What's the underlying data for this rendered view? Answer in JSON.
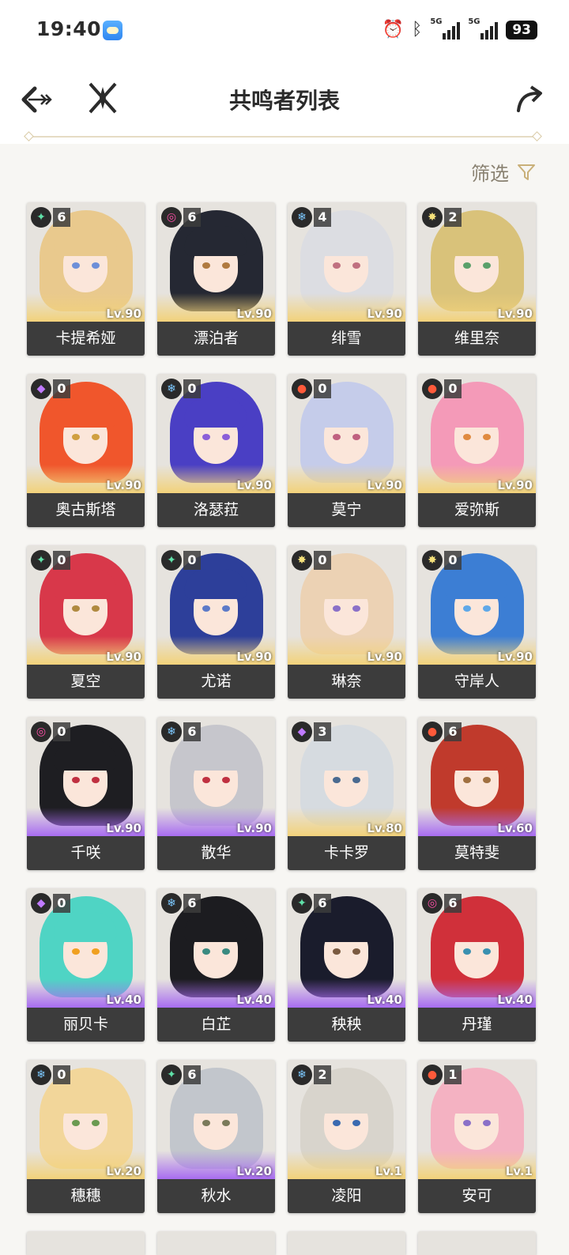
{
  "status_bar": {
    "time": "19:40",
    "battery": "93",
    "signal1_tag": "5G",
    "signal2_tag": "5G"
  },
  "header": {
    "title": "共鸣者列表"
  },
  "filter": {
    "label": "筛选"
  },
  "colors": {
    "accent": "#c9b079",
    "namebar": "#3c3c3c",
    "card_bg": "#e6e3de",
    "purple_glow": "#a86cf0",
    "gold_glow": "#f2d27a"
  },
  "elements": {
    "aero": {
      "glyph": "✦",
      "color": "#5fe0a8"
    },
    "spectro": {
      "glyph": "✸",
      "color": "#f4e07a"
    },
    "glacio": {
      "glyph": "❄",
      "color": "#7cc8ff"
    },
    "fusion": {
      "glyph": "●",
      "color": "#ff5a3a"
    },
    "electro": {
      "glyph": "◆",
      "color": "#c07aff"
    },
    "havoc": {
      "glyph": "◎",
      "color": "#ff4fa8"
    }
  },
  "characters": [
    {
      "name": "卡提希娅",
      "level": "Lv.90",
      "constellation": "6",
      "element": "aero",
      "rarity": "5",
      "hair": "#e9c98d",
      "eye": "#6d8fd8"
    },
    {
      "name": "漂泊者",
      "level": "Lv.90",
      "constellation": "6",
      "element": "havoc",
      "rarity": "5",
      "hair": "#252833",
      "eye": "#b07a40"
    },
    {
      "name": "绯雪",
      "level": "Lv.90",
      "constellation": "4",
      "element": "glacio",
      "rarity": "5",
      "hair": "#dcdde2",
      "eye": "#c07080"
    },
    {
      "name": "维里奈",
      "level": "Lv.90",
      "constellation": "2",
      "element": "spectro",
      "rarity": "5",
      "hair": "#d9c27a",
      "eye": "#5aa06a"
    },
    {
      "name": "奥古斯塔",
      "level": "Lv.90",
      "constellation": "0",
      "element": "electro",
      "rarity": "5",
      "hair": "#f0562c",
      "eye": "#d0a040"
    },
    {
      "name": "洛瑟菈",
      "level": "Lv.90",
      "constellation": "0",
      "element": "glacio",
      "rarity": "5",
      "hair": "#4a3fc4",
      "eye": "#8b5ed8"
    },
    {
      "name": "莫宁",
      "level": "Lv.90",
      "constellation": "0",
      "element": "fusion",
      "rarity": "5",
      "hair": "#c5ccea",
      "eye": "#c06080"
    },
    {
      "name": "爱弥斯",
      "level": "Lv.90",
      "constellation": "0",
      "element": "fusion",
      "rarity": "5",
      "hair": "#f49ab8",
      "eye": "#e08a40"
    },
    {
      "name": "夏空",
      "level": "Lv.90",
      "constellation": "0",
      "element": "aero",
      "rarity": "5",
      "hair": "#d8384a",
      "eye": "#b08a40"
    },
    {
      "name": "尤诺",
      "level": "Lv.90",
      "constellation": "0",
      "element": "aero",
      "rarity": "5",
      "hair": "#2d3f9a",
      "eye": "#5c7ac8"
    },
    {
      "name": "琳奈",
      "level": "Lv.90",
      "constellation": "0",
      "element": "spectro",
      "rarity": "5",
      "hair": "#ecd2b4",
      "eye": "#8a70c8"
    },
    {
      "name": "守岸人",
      "level": "Lv.90",
      "constellation": "0",
      "element": "spectro",
      "rarity": "5",
      "hair": "#3c7ed4",
      "eye": "#5fa8e8"
    },
    {
      "name": "千咲",
      "level": "Lv.90",
      "constellation": "0",
      "element": "havoc",
      "rarity": "4",
      "hair": "#1e1e22",
      "eye": "#c03040"
    },
    {
      "name": "散华",
      "level": "Lv.90",
      "constellation": "6",
      "element": "glacio",
      "rarity": "4",
      "hair": "#c6c6cc",
      "eye": "#c03040"
    },
    {
      "name": "卡卡罗",
      "level": "Lv.80",
      "constellation": "3",
      "element": "electro",
      "rarity": "5",
      "hair": "#d6dbe0",
      "eye": "#4a6a90"
    },
    {
      "name": "莫特斐",
      "level": "Lv.60",
      "constellation": "6",
      "element": "fusion",
      "rarity": "4",
      "hair": "#c03a2c",
      "eye": "#a07040"
    },
    {
      "name": "丽贝卡",
      "level": "Lv.40",
      "constellation": "0",
      "element": "electro",
      "rarity": "4",
      "hair": "#4fd4c4",
      "eye": "#f0a020"
    },
    {
      "name": "白芷",
      "level": "Lv.40",
      "constellation": "6",
      "element": "glacio",
      "rarity": "4",
      "hair": "#1c1c20",
      "eye": "#3a8a80"
    },
    {
      "name": "秧秧",
      "level": "Lv.40",
      "constellation": "6",
      "element": "aero",
      "rarity": "4",
      "hair": "#1a1c2c",
      "eye": "#7a5a40"
    },
    {
      "name": "丹瑾",
      "level": "Lv.40",
      "constellation": "6",
      "element": "havoc",
      "rarity": "4",
      "hair": "#d0303a",
      "eye": "#3a90b0"
    },
    {
      "name": "穗穗",
      "level": "Lv.20",
      "constellation": "0",
      "element": "glacio",
      "rarity": "5",
      "hair": "#f2d69a",
      "eye": "#6a9a50"
    },
    {
      "name": "秋水",
      "level": "Lv.20",
      "constellation": "6",
      "element": "aero",
      "rarity": "4",
      "hair": "#c2c6cc",
      "eye": "#7a7a5a"
    },
    {
      "name": "凌阳",
      "level": "Lv.1",
      "constellation": "2",
      "element": "glacio",
      "rarity": "5",
      "hair": "#d8d4cc",
      "eye": "#3a6ab0"
    },
    {
      "name": "安可",
      "level": "Lv.1",
      "constellation": "1",
      "element": "fusion",
      "rarity": "5",
      "hair": "#f4b2c2",
      "eye": "#8a70c8"
    }
  ]
}
